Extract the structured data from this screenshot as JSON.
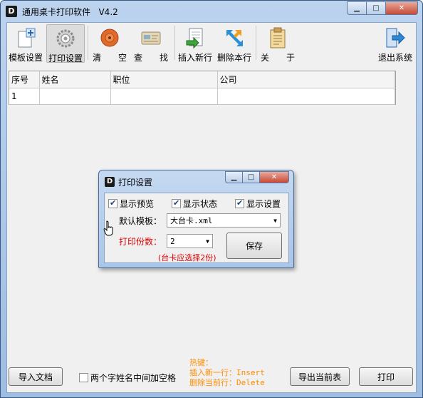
{
  "window": {
    "title": "通用桌卡打印软件",
    "version": "V4.2",
    "app_icon": "D"
  },
  "toolbar": {
    "items": [
      {
        "label": "模板设置",
        "icon": "template-icon"
      },
      {
        "label": "打印设置",
        "icon": "gear-icon"
      },
      {
        "label": "清　　空",
        "icon": "clear-icon"
      },
      {
        "label": "查　　找",
        "icon": "search-card-icon"
      },
      {
        "label": "插入新行",
        "icon": "insert-row-icon"
      },
      {
        "label": "删除本行",
        "icon": "delete-row-icon"
      },
      {
        "label": "关　　于",
        "icon": "about-icon"
      },
      {
        "label": "退出系统",
        "icon": "exit-icon"
      }
    ]
  },
  "grid": {
    "columns": [
      "序号",
      "姓名",
      "职位",
      "公司"
    ],
    "rows": [
      [
        "1",
        "",
        "",
        ""
      ]
    ]
  },
  "bottom": {
    "import_label": "导入文档",
    "space_checkbox_label": "两个字姓名中间加空格",
    "hotkey_title": "热键：",
    "hotkey_insert": "插入新一行：Insert",
    "hotkey_delete": "删除当前行：Delete",
    "export_label": "导出当前表",
    "print_label": "打印"
  },
  "dialog": {
    "title": "打印设置",
    "show_preview": "显示预览",
    "show_status": "显示状态",
    "show_settings": "显示设置",
    "template_label": "默认模板：",
    "template_value": "大台卡.xml",
    "copies_label": "打印份数：",
    "copies_value": "2",
    "save_label": "保存",
    "note": "(台卡应选择2份)"
  },
  "colors": {
    "accent_red": "#e00000",
    "hotkey_orange": "#ff8c00"
  }
}
